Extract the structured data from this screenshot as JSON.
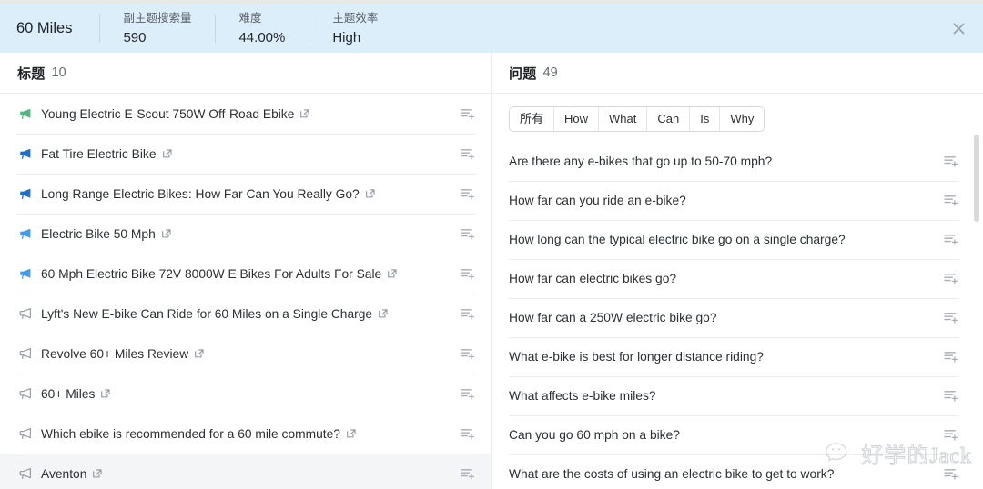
{
  "header": {
    "keyword": "60 Miles",
    "metrics": [
      {
        "label": "副主题搜索量",
        "value": "590"
      },
      {
        "label": "难度",
        "value": "44.00%"
      },
      {
        "label": "主题效率",
        "value": "High"
      }
    ],
    "close_icon": "close-icon",
    "background_color": "#ddeefb"
  },
  "left_pane": {
    "title": "标题",
    "count": "10",
    "items": [
      {
        "text": "Young Electric E-Scout 750W Off-Road Ebike",
        "icon": "megaphone-icon",
        "icon_color": "#4cb97f",
        "has_link": true,
        "add_icon": "add-to-list-icon"
      },
      {
        "text": "Fat Tire Electric Bike",
        "icon": "megaphone-icon",
        "icon_color": "#1a6fd4",
        "has_link": true,
        "add_icon": "add-to-list-icon"
      },
      {
        "text": "Long Range Electric Bikes: How Far Can You Really Go?",
        "icon": "megaphone-icon",
        "icon_color": "#1a6fd4",
        "has_link": true,
        "add_icon": "add-to-list-icon"
      },
      {
        "text": "Electric Bike 50 Mph",
        "icon": "megaphone-icon",
        "icon_color": "#3d9df5",
        "has_link": true,
        "add_icon": "add-to-list-icon"
      },
      {
        "text": "60 Mph Electric Bike 72V 8000W E Bikes For Adults For Sale",
        "icon": "megaphone-icon",
        "icon_color": "#3d9df5",
        "has_link": true,
        "add_icon": "add-to-list-icon"
      },
      {
        "text": "Lyft's New E-bike Can Ride for 60 Miles on a Single Charge",
        "icon": "megaphone-outline-icon",
        "icon_color": "#9aa1aa",
        "has_link": true,
        "add_icon": "add-to-list-icon"
      },
      {
        "text": "Revolve 60+ Miles Review",
        "icon": "megaphone-outline-icon",
        "icon_color": "#9aa1aa",
        "has_link": true,
        "add_icon": "add-to-list-icon"
      },
      {
        "text": "60+ Miles",
        "icon": "megaphone-outline-icon",
        "icon_color": "#9aa1aa",
        "has_link": true,
        "add_icon": "add-to-list-icon"
      },
      {
        "text": "Which ebike is recommended for a 60 mile commute?",
        "icon": "megaphone-outline-icon",
        "icon_color": "#9aa1aa",
        "has_link": true,
        "add_icon": "add-to-list-icon"
      },
      {
        "text": "Aventon",
        "icon": "megaphone-outline-icon",
        "icon_color": "#9aa1aa",
        "has_link": true,
        "add_icon": "add-to-list-icon"
      }
    ]
  },
  "right_pane": {
    "title": "问题",
    "count": "49",
    "filters": [
      {
        "label": "所有",
        "selected": true
      },
      {
        "label": "How",
        "selected": false
      },
      {
        "label": "What",
        "selected": false
      },
      {
        "label": "Can",
        "selected": false
      },
      {
        "label": "Is",
        "selected": false
      },
      {
        "label": "Why",
        "selected": false
      }
    ],
    "questions": [
      {
        "text": "Are there any e-bikes that go up to 50-70 mph?",
        "add_icon": "add-to-list-icon"
      },
      {
        "text": "How far can you ride an e-bike?",
        "add_icon": "add-to-list-icon"
      },
      {
        "text": "How long can the typical electric bike go on a single charge?",
        "add_icon": "add-to-list-icon"
      },
      {
        "text": "How far can electric bikes go?",
        "add_icon": "add-to-list-icon"
      },
      {
        "text": "How far can a 250W electric bike go?",
        "add_icon": "add-to-list-icon"
      },
      {
        "text": "What e-bike is best for longer distance riding?",
        "add_icon": "add-to-list-icon"
      },
      {
        "text": "What affects e-bike miles?",
        "add_icon": "add-to-list-icon"
      },
      {
        "text": "Can you go 60 mph on a bike?",
        "add_icon": "add-to-list-icon"
      },
      {
        "text": "What are the costs of using an electric bike to get to work?",
        "add_icon": "add-to-list-icon"
      }
    ]
  },
  "watermark": {
    "text": "好学的Jack",
    "logo_icon": "wechat-icon"
  }
}
